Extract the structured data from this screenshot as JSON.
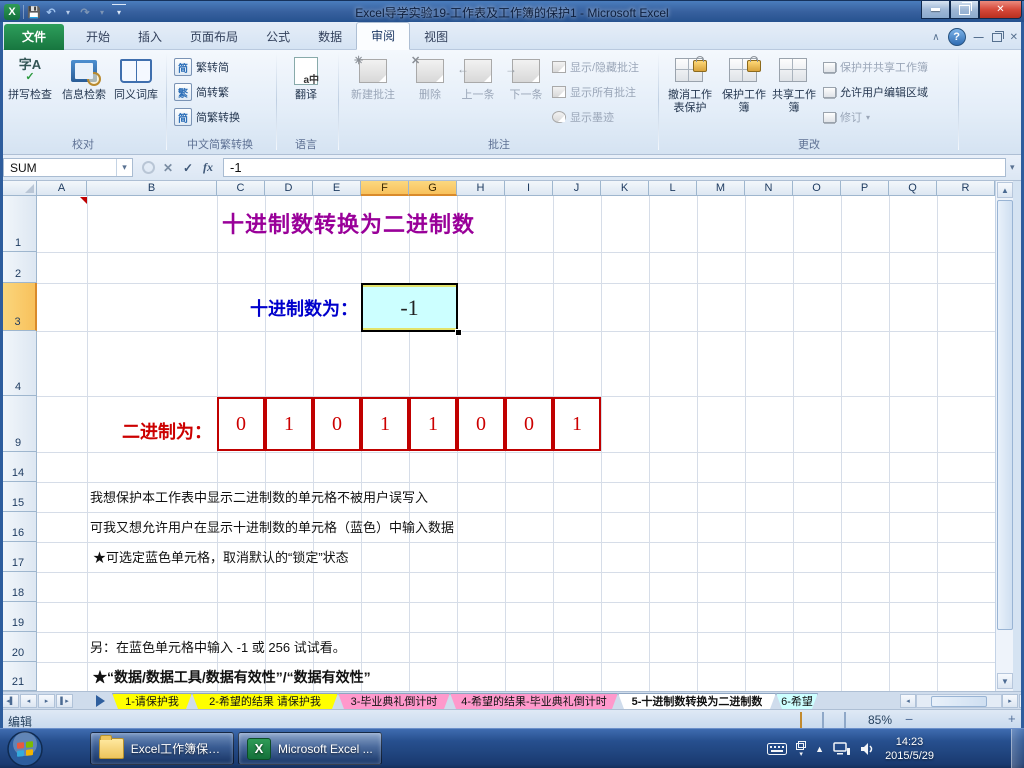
{
  "window": {
    "title": "Excel导学实验19-工作表及工作簿的保护1 - Microsoft Excel"
  },
  "ribbon": {
    "file_tab": "文件",
    "tabs": [
      "开始",
      "插入",
      "页面布局",
      "公式",
      "数据",
      "审阅",
      "视图"
    ],
    "active_tab": "审阅",
    "proofing": {
      "label": "校对",
      "spell": "拼写检查",
      "research": "信息检索",
      "thesaurus": "同义词库",
      "spell_glyph": "字A"
    },
    "chinese": {
      "label": "中文简繁转换",
      "trad_to_simp": "繁转简",
      "simp_to_trad": "简转繁",
      "convert": "简繁转换",
      "glyph_simp": "简",
      "glyph_trad": "繁"
    },
    "language": {
      "label": "语言",
      "translate": "翻译",
      "translate_glyph": "a中"
    },
    "comments": {
      "label": "批注",
      "new_comment": "新建批注",
      "delete": "删除",
      "previous": "上一条",
      "next": "下一条",
      "show_hide": "显示/隐藏批注",
      "show_all": "显示所有批注",
      "show_ink": "显示墨迹"
    },
    "changes": {
      "label": "更改",
      "unprotect_sheet": "撤消工作表保护",
      "protect_workbook": "保护工作簿",
      "share_workbook": "共享工作簿",
      "protect_and_share": "保护并共享工作簿",
      "allow_users": "允许用户编辑区域",
      "track_changes": "修订"
    }
  },
  "formula_bar": {
    "name_box": "SUM",
    "fx_label": "fx",
    "formula": "-1"
  },
  "grid": {
    "columns": [
      "A",
      "B",
      "C",
      "D",
      "E",
      "F",
      "G",
      "H",
      "I",
      "J",
      "K",
      "L",
      "M",
      "N",
      "O",
      "P",
      "Q",
      "R"
    ],
    "rows": [
      "1",
      "2",
      "3",
      "4",
      "9",
      "14",
      "15",
      "16",
      "17",
      "18",
      "19",
      "20",
      "21"
    ],
    "highlighted_columns": [
      "F",
      "G"
    ],
    "highlighted_row": "3"
  },
  "sheet_content": {
    "title": "十进制数转换为二进制数",
    "decimal_label": "十进制数为：",
    "decimal_value": "-1",
    "binary_label": "二进制为：",
    "binary_digits": [
      "0",
      "1",
      "0",
      "1",
      "1",
      "0",
      "0",
      "1"
    ],
    "note_protect": "我想保护本工作表中显示二进制数的单元格不被用户误写入",
    "note_allow": "可我又想允许用户在显示十进制数的单元格（蓝色）中输入数据",
    "note_unlock": "★可选定蓝色单元格，取消默认的“锁定”状态",
    "note_try": "另：在蓝色单元格中输入 -1 或 256 试试看。",
    "note_validation": "★“数据/数据工具/数据有效性”/“数据有效性”",
    "colors": {
      "title": "#990099",
      "decimal_label": "#0000cc",
      "decimal_cell_bg": "#ccffff",
      "binary": "#cc0000"
    }
  },
  "sheet_tabs": {
    "tabs": [
      {
        "label": "1-请保护我",
        "color": "#ffff00"
      },
      {
        "label": "2-希望的结果 请保护我",
        "color": "#ffff00"
      },
      {
        "label": "3-毕业典礼倒计时",
        "color": "#ff99cc"
      },
      {
        "label": "4-希望的结果-毕业典礼倒计时",
        "color": "#ff99cc"
      },
      {
        "label": "5-十进制数转换为二进制数",
        "color": "#ffffff"
      },
      {
        "label": "6-希望",
        "color": "#ccffff"
      }
    ],
    "active_index": 4
  },
  "status_bar": {
    "mode": "编辑",
    "zoom_level": "85%"
  },
  "taskbar": {
    "apps": [
      {
        "label": "Excel工作簿保护..."
      },
      {
        "label": "Microsoft Excel ..."
      }
    ],
    "clock": {
      "time": "14:23",
      "date": "2015/5/29"
    }
  }
}
